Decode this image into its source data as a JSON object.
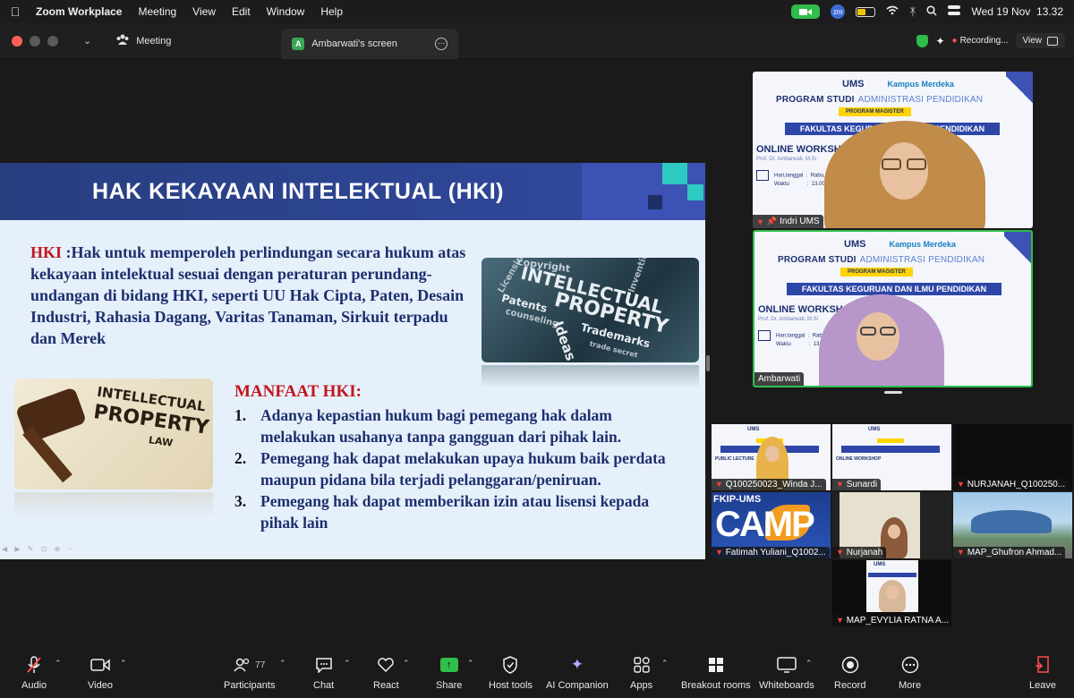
{
  "menubar": {
    "app_name": "Zoom Workplace",
    "items": [
      "Meeting",
      "View",
      "Edit",
      "Window",
      "Help"
    ],
    "zm_badge": "zm",
    "datetime": "Wed 19 Nov  13.32"
  },
  "titlebar": {
    "tab_meeting": "Meeting",
    "tab_screen": "Ambarwati's screen",
    "tab_screen_avatar": "A",
    "recording": "Recording...",
    "view": "View"
  },
  "slide": {
    "title": "HAK KEKAYAAN INTELEKTUAL (HKI)",
    "hki_label": "HKI",
    "hki_definition": " :Hak untuk memperoleh perlindungan secara hukum atas kekayaan intelektual sesuai dengan peraturan perundang-undangan di bidang HKI, seperti UU Hak Cipta, Paten, Desain Industri, Rahasia Dagang, Varitas Tanaman, Sirkuit terpadu dan Merek",
    "manfaat_title": "MANFAAT HKI:",
    "manfaat": [
      {
        "num": "1.",
        "text": "Adanya kepastian hukum bagi pemegang hak dalam melakukan usahanya tanpa gangguan dari pihak lain."
      },
      {
        "num": "2.",
        "text": "Pemegang hak dapat melakukan upaya hukum baik perdata maupun pidana bila terjadi pelanggaran/peniruan."
      },
      {
        "num": "3.",
        "text": "Pemegang hak dapat memberikan izin atau lisensi kepada pihak lain"
      }
    ],
    "image_ip_words": {
      "top": "INTELLECTUAL",
      "bottom": "PROPERTY",
      "a": "copyright",
      "b": "Patents",
      "c": "Trademarks",
      "d": "Invention",
      "e": "Licensing",
      "f": "counseling",
      "g": "Ideas",
      "h": "trade secret"
    },
    "image_law_words": {
      "l1": "INTELLECTUAL",
      "l2": "PROPERTY",
      "l3": "LAW"
    }
  },
  "big_tiles": [
    {
      "name": "Indri UMS",
      "logo": "UMS",
      "merdeka": "Kampus Merdeka",
      "program": "PROGRAM STUDI",
      "admin": "ADMINISTRASI PENDIDIKAN",
      "magister": "PROGRAM MAGISTER",
      "fakultas": "FAKULTAS KEGURUAN DAN ILMU PENDIDIKAN",
      "workshop": "ONLINE WORKSHOP",
      "prof": "Prof. Dr. Ambarwati, M.Si",
      "info1": "Hari,tanggal  :  Rabu, 19 November",
      "info2": "Waktu            :  13.00 - selesai"
    },
    {
      "name": "Ambarwati",
      "logo": "UMS",
      "merdeka": "Kampus Merdeka",
      "program": "PROGRAM STUDI",
      "admin": "ADMINISTRASI PENDIDIKAN",
      "magister": "PROGRAM MAGISTER",
      "fakultas": "FAKULTAS KEGURUAN DAN ILMU PENDIDIKAN",
      "workshop": "ONLINE WORKSHOP",
      "prof": "Prof. Dr. Ambarwati, M.Si",
      "info1": "Hari,tanggal  :  Rabu, 19 November",
      "info2": "Waktu            :  13.00 - selesai"
    }
  ],
  "gallery": [
    {
      "name": "Q100250023_Winda J...",
      "mini": "PUBLIC LECTURE"
    },
    {
      "name": "Sunardi",
      "mini": "ONLINE WORKSHOP"
    },
    {
      "name": "NURJANAH_Q100250..."
    },
    {
      "name": "Fatimah Yuliani_Q1002...",
      "fkip": "FKIP-UMS",
      "big": "CAMP"
    },
    {
      "name": "Nurjanah"
    },
    {
      "name": "MAP_Ghufron Ahmad..."
    },
    {
      "name": "MAP_EVYLIA RATNA A..."
    }
  ],
  "toolbar": {
    "audio": "Audio",
    "video": "Video",
    "participants": "Participants",
    "participants_count": "77",
    "chat": "Chat",
    "react": "React",
    "share": "Share",
    "host_tools": "Host tools",
    "ai_companion": "AI Companion",
    "apps": "Apps",
    "breakout": "Breakout rooms",
    "whiteboards": "Whiteboards",
    "record": "Record",
    "more": "More",
    "leave": "Leave"
  },
  "colors": {
    "share_green": "#2fbd4b",
    "leave_red": "#ff4d4d",
    "slide_navy": "#1d2f6e",
    "slide_red": "#c0161d"
  }
}
